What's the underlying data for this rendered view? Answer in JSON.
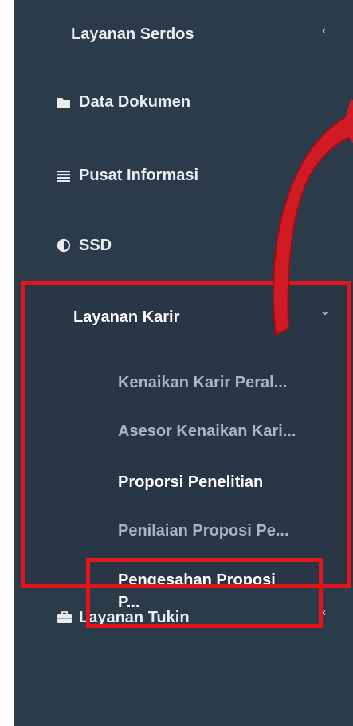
{
  "sidebar": {
    "top_item": {
      "label": "Layanan Serdos"
    },
    "items": [
      {
        "label": "Data Dokumen",
        "icon": "folder-icon"
      },
      {
        "label": "Pusat Informasi",
        "icon": "list-icon"
      },
      {
        "label": "SSD",
        "icon": "half-circle-icon"
      }
    ],
    "group": {
      "label": "Layanan Karir",
      "subitems": [
        {
          "label": "Kenaikan Karir Peral..."
        },
        {
          "label": "Asesor Kenaikan Kari..."
        },
        {
          "label": "Proporsi Penelitian"
        },
        {
          "label": "Penilaian Proposi Pe..."
        },
        {
          "label": "Pengesahan Proposi"
        },
        {
          "label": "P..."
        }
      ]
    },
    "bottom_item": {
      "label": "Layanan Tukin",
      "icon": "briefcase-icon"
    }
  },
  "colors": {
    "sidebar_bg": "#2c3b4a",
    "highlight_red": "#e3141c",
    "submenu_inactive": "#a9b7c4"
  }
}
